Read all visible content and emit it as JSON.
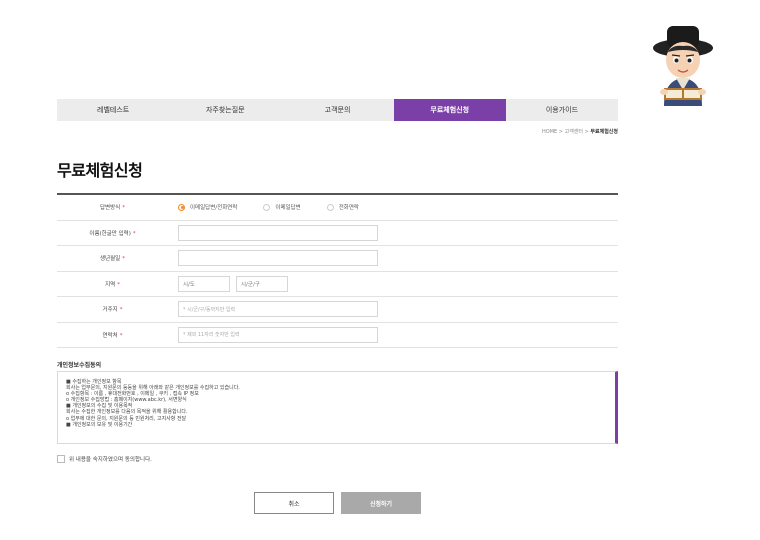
{
  "nav": {
    "tabs": [
      "레벨테스트",
      "자주찾는질문",
      "고객문의",
      "무료체험신청",
      "이용가이드"
    ],
    "active_index": 3
  },
  "breadcrumb": {
    "home": "HOME",
    "parent": "고객센터",
    "current": "무료체험신청",
    "separator": ">"
  },
  "page_title": "무료체험신청",
  "form": {
    "required_mark": "*",
    "answer_method": {
      "label": "답변방식",
      "options": [
        "이메일답변/전화연락",
        "이메일답변",
        "전화연락"
      ],
      "selected": 0
    },
    "name": {
      "label": "이름(한글만 입력)",
      "value": ""
    },
    "birth": {
      "label": "생년월일",
      "value": ""
    },
    "region": {
      "label": "지역",
      "city_placeholder": "시/도",
      "district_placeholder": "시/군/구"
    },
    "address": {
      "label": "거주지",
      "placeholder": "* 시/군/구/동까지만 입력"
    },
    "contact": {
      "label": "연락처",
      "placeholder": "* 제외 11자리 숫자만 입력"
    }
  },
  "privacy": {
    "title": "개인정보수집동의",
    "lines": [
      "■ 수집하는 개인정보 항목",
      "회사는 업무문의, 지원문의 등등을 위해 아래와 같은 개인정보를 수집하고 있습니다.",
      "o 수집항목 : 이름 , 휴대전화번호 , 이메일 , 쿠키 , 접속 IP 정보",
      "o 개인정보 수집방법 : 홈페이지(www.abc.kr), 서면양식",
      "■ 개인정보의 수집 및 이용목적",
      "회사는 수집한 개인정보를 다음의 목적을 위해 활용합니다.",
      "o 업무에 대한 문의, 지원문의 등 민원처리, 고지사항 전달",
      "■ 개인정보의 보유 및 이용기간"
    ]
  },
  "agree_label": "위 내용을 숙지하였으며 동의합니다.",
  "buttons": {
    "cancel": "취소",
    "submit": "신청하기"
  },
  "colors": {
    "accent": "#7b3fa8",
    "required": "#e03c3c",
    "radio_selected": "#f08a2a",
    "submit_bg": "#a9a9a9"
  }
}
